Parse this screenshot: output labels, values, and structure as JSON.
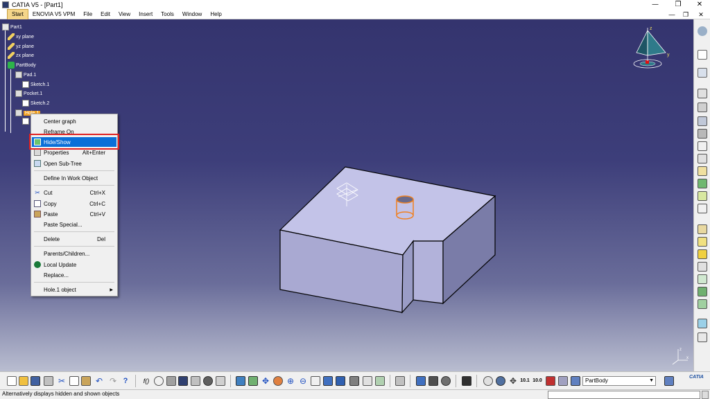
{
  "window": {
    "title": "CATIA V5 - [Part1]",
    "minimize": "—",
    "restore": "❐",
    "close": "✕"
  },
  "menubar": {
    "items": [
      "Start",
      "ENOVIA V5 VPM",
      "File",
      "Edit",
      "View",
      "Insert",
      "Tools",
      "Window",
      "Help"
    ],
    "doc_min": "—",
    "doc_restore": "❐",
    "doc_close": "✕"
  },
  "tree": {
    "root": "Part1",
    "xy": "xy plane",
    "yz": "yz plane",
    "zx": "zx plane",
    "body": "PartBody",
    "pad": "Pad.1",
    "sketch1": "Sketch.1",
    "pocket": "Pocket.1",
    "sketch2": "Sketch.2",
    "hole": "Hole.1"
  },
  "context_menu": {
    "center_graph": "Center graph",
    "reframe_on": "Reframe On",
    "hide_show": "Hide/Show",
    "properties": "Properties",
    "properties_key": "Alt+Enter",
    "open_subtree": "Open Sub-Tree",
    "define_work_object": "Define In Work Object",
    "cut": "Cut",
    "cut_key": "Ctrl+X",
    "copy": "Copy",
    "copy_key": "Ctrl+C",
    "paste": "Paste",
    "paste_key": "Ctrl+V",
    "paste_special": "Paste Special...",
    "delete": "Delete",
    "delete_key": "Del",
    "parents_children": "Parents/Children...",
    "local_update": "Local Update",
    "replace": "Replace...",
    "hole_object": "Hole.1 object",
    "submenu_arrow": "▶"
  },
  "compass": {
    "x_label": "x",
    "y_label": "y",
    "z_label": "z"
  },
  "toolbar": {
    "body_select": "PartBody",
    "select_arrow": "▼",
    "logo": "CATIA"
  },
  "status": {
    "text": "Alternatively displays hidden and shown objects"
  },
  "colors": {
    "viewport_top": "#34346e",
    "viewport_bottom": "#b9bdd0",
    "part_top": "#c3c3e8",
    "part_front": "#a9a9d2",
    "part_side": "#7a7ca8",
    "selection_orange": "#f08020",
    "menu_highlight": "#0a6fd8",
    "callout_red": "#e02020"
  }
}
